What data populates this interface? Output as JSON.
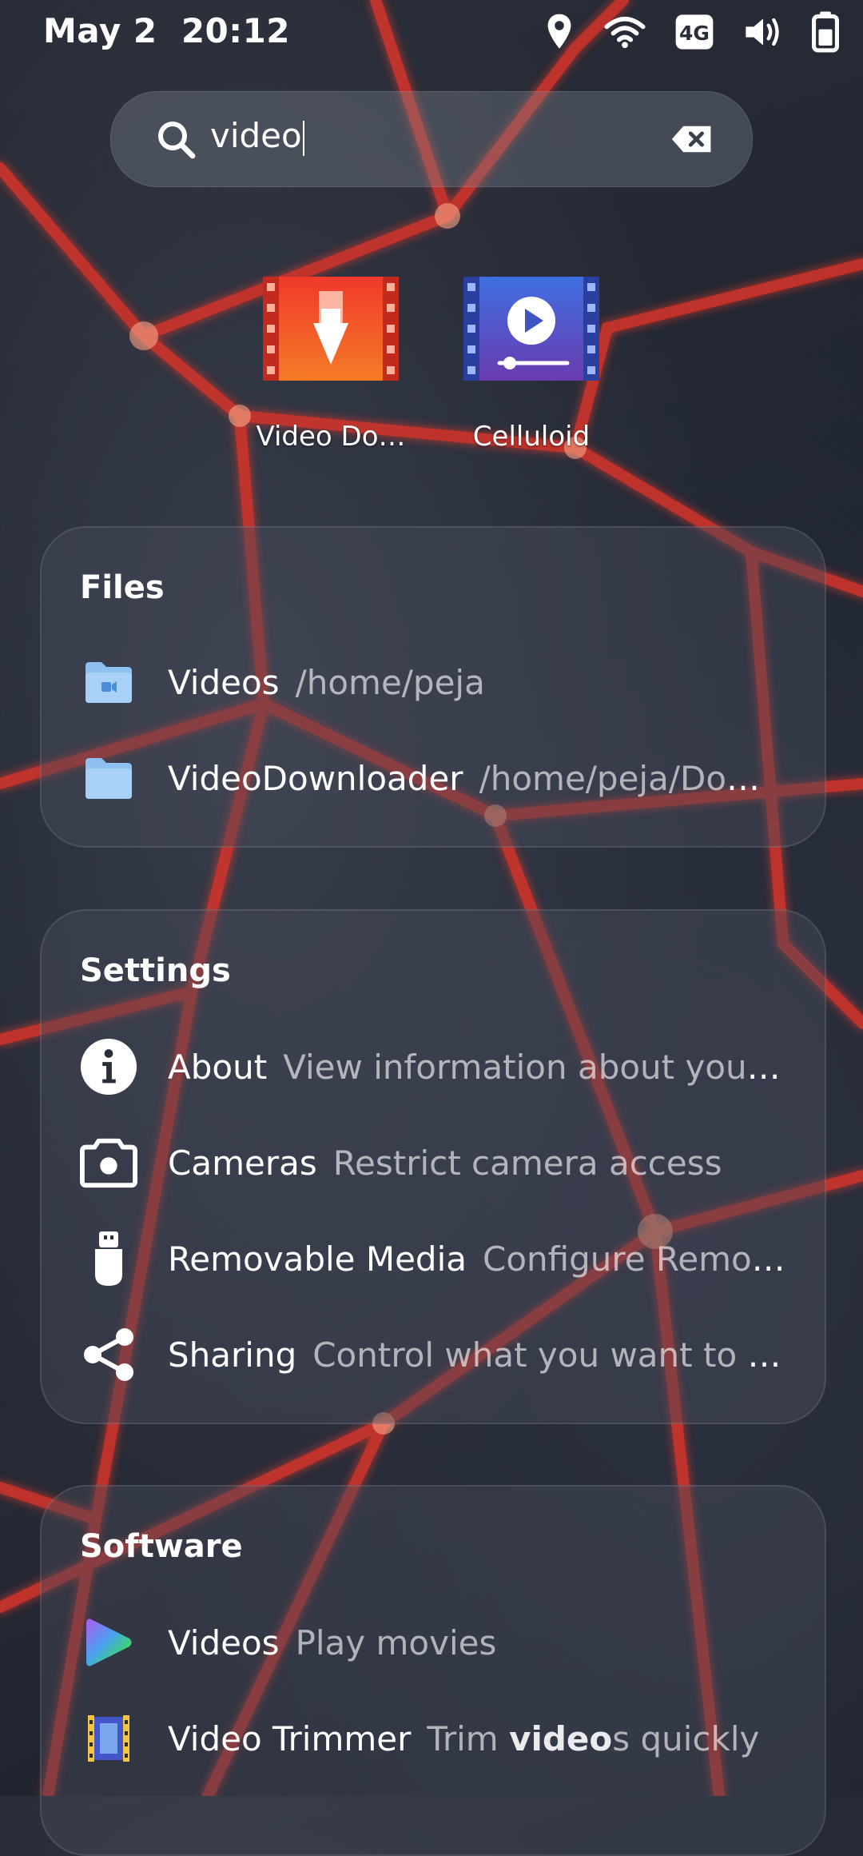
{
  "status": {
    "date": "May 2",
    "time": "20:12",
    "icons": [
      "location-icon",
      "wifi-icon",
      "network-4g-icon",
      "volume-icon",
      "battery-icon"
    ],
    "network_label": "4G"
  },
  "search": {
    "query": "video",
    "icon": "search-icon",
    "clear_icon": "backspace-clear-icon"
  },
  "apps": [
    {
      "label": "Video Do…",
      "icon": "video-downloader-icon",
      "accent": "#e8492a"
    },
    {
      "label": "Celluloid",
      "icon": "celluloid-icon",
      "accent": "#3a57c4"
    }
  ],
  "files": {
    "title": "Files",
    "items": [
      {
        "name": "Videos",
        "path": "/home/peja",
        "icon": "videos-folder-icon"
      },
      {
        "name": "VideoDownloader",
        "path": "/home/peja/Down…",
        "icon": "folder-icon"
      }
    ]
  },
  "settings": {
    "title": "Settings",
    "items": [
      {
        "name": "About",
        "desc": "View information about your s…",
        "icon": "info-icon"
      },
      {
        "name": "Cameras",
        "desc": "Restrict camera access",
        "icon": "camera-icon"
      },
      {
        "name": "Removable Media",
        "desc": "Configure Remova…",
        "icon": "usb-drive-icon"
      },
      {
        "name": "Sharing",
        "desc": "Control what you want to sh…",
        "icon": "share-icon"
      }
    ]
  },
  "software": {
    "title": "Software",
    "items": [
      {
        "name": "Videos",
        "desc_pre": "Play movies",
        "desc_bold": "",
        "desc_post": "",
        "icon": "videos-app-icon"
      },
      {
        "name": "Video Trimmer",
        "desc_pre": "Trim ",
        "desc_bold": "video",
        "desc_post": "s quickly",
        "icon": "video-trimmer-icon"
      }
    ]
  },
  "colors": {
    "panel": "rgba(70,76,90,0.45)",
    "wallpaper_glow": "#ff3b2a",
    "folder": "#9cc7f3"
  }
}
